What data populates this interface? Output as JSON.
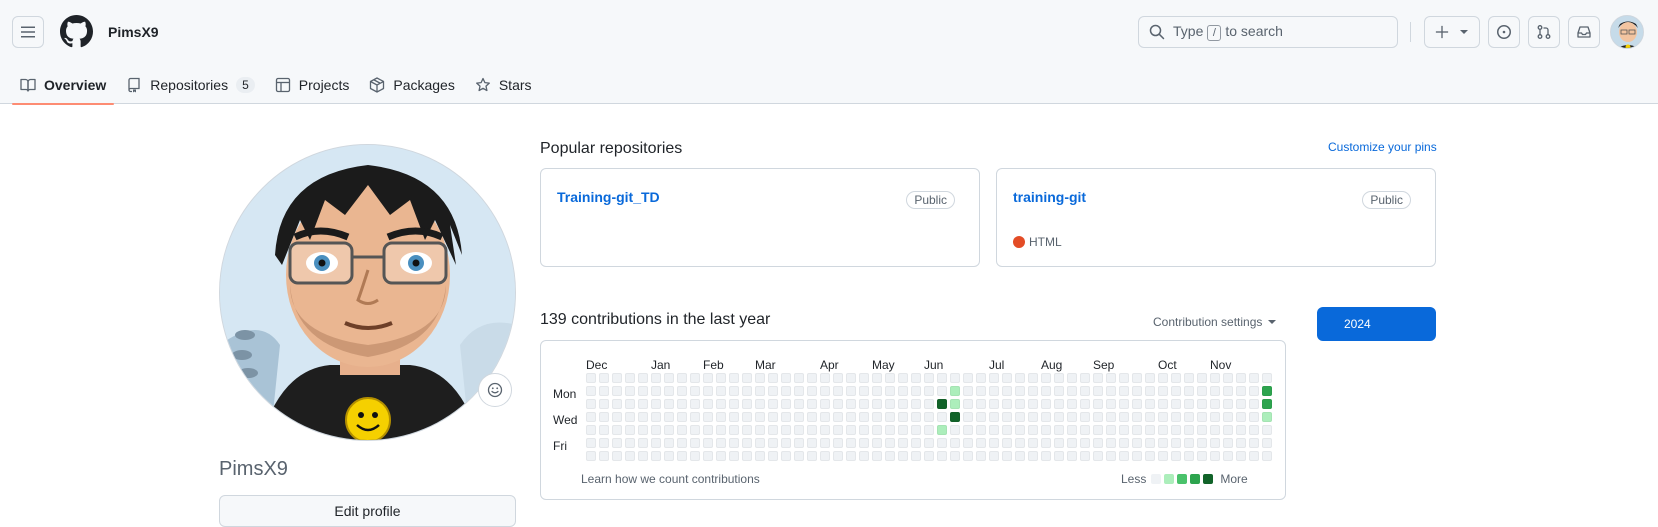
{
  "header": {
    "username": "PimsX9",
    "search_placeholder_prefix": "Type",
    "search_key": "/",
    "search_placeholder_suffix": "to search"
  },
  "tabs": [
    {
      "label": "Overview",
      "icon": "book-icon",
      "active": true
    },
    {
      "label": "Repositories",
      "icon": "repo-icon",
      "count": "5"
    },
    {
      "label": "Projects",
      "icon": "table-icon"
    },
    {
      "label": "Packages",
      "icon": "package-icon"
    },
    {
      "label": "Stars",
      "icon": "star-icon"
    }
  ],
  "profile": {
    "name": "PimsX9",
    "edit_label": "Edit profile"
  },
  "popular": {
    "title": "Popular repositories",
    "customize_label": "Customize your pins",
    "repos": [
      {
        "name": "Training-git_TD",
        "visibility": "Public",
        "language": ""
      },
      {
        "name": "training-git",
        "visibility": "Public",
        "language": "HTML",
        "language_color": "#e34c26"
      }
    ]
  },
  "contributions": {
    "title": "139 contributions in the last year",
    "settings_label": "Contribution settings",
    "year": "2024",
    "months": [
      "Dec",
      "Jan",
      "Feb",
      "Mar",
      "Apr",
      "May",
      "Jun",
      "Jul",
      "Aug",
      "Sep",
      "Oct",
      "Nov"
    ],
    "days": [
      "Mon",
      "Wed",
      "Fri"
    ],
    "learn_label": "Learn how we count contributions",
    "legend_less": "Less",
    "legend_more": "More",
    "levels": [
      "#eff2f5",
      "#aceebb",
      "#4ac26b",
      "#2da44e",
      "#116329"
    ],
    "active_cells": [
      {
        "week": 27,
        "day": 2,
        "level": 4
      },
      {
        "week": 27,
        "day": 4,
        "level": 1
      },
      {
        "week": 28,
        "day": 1,
        "level": 1
      },
      {
        "week": 28,
        "day": 2,
        "level": 1
      },
      {
        "week": 28,
        "day": 3,
        "level": 4
      },
      {
        "week": 52,
        "day": 1,
        "level": 3
      },
      {
        "week": 52,
        "day": 2,
        "level": 3
      },
      {
        "week": 52,
        "day": 3,
        "level": 1
      }
    ],
    "weeks": 53
  },
  "colors": {
    "accent": "#0969da",
    "tab_underline": "#fd8c73"
  }
}
